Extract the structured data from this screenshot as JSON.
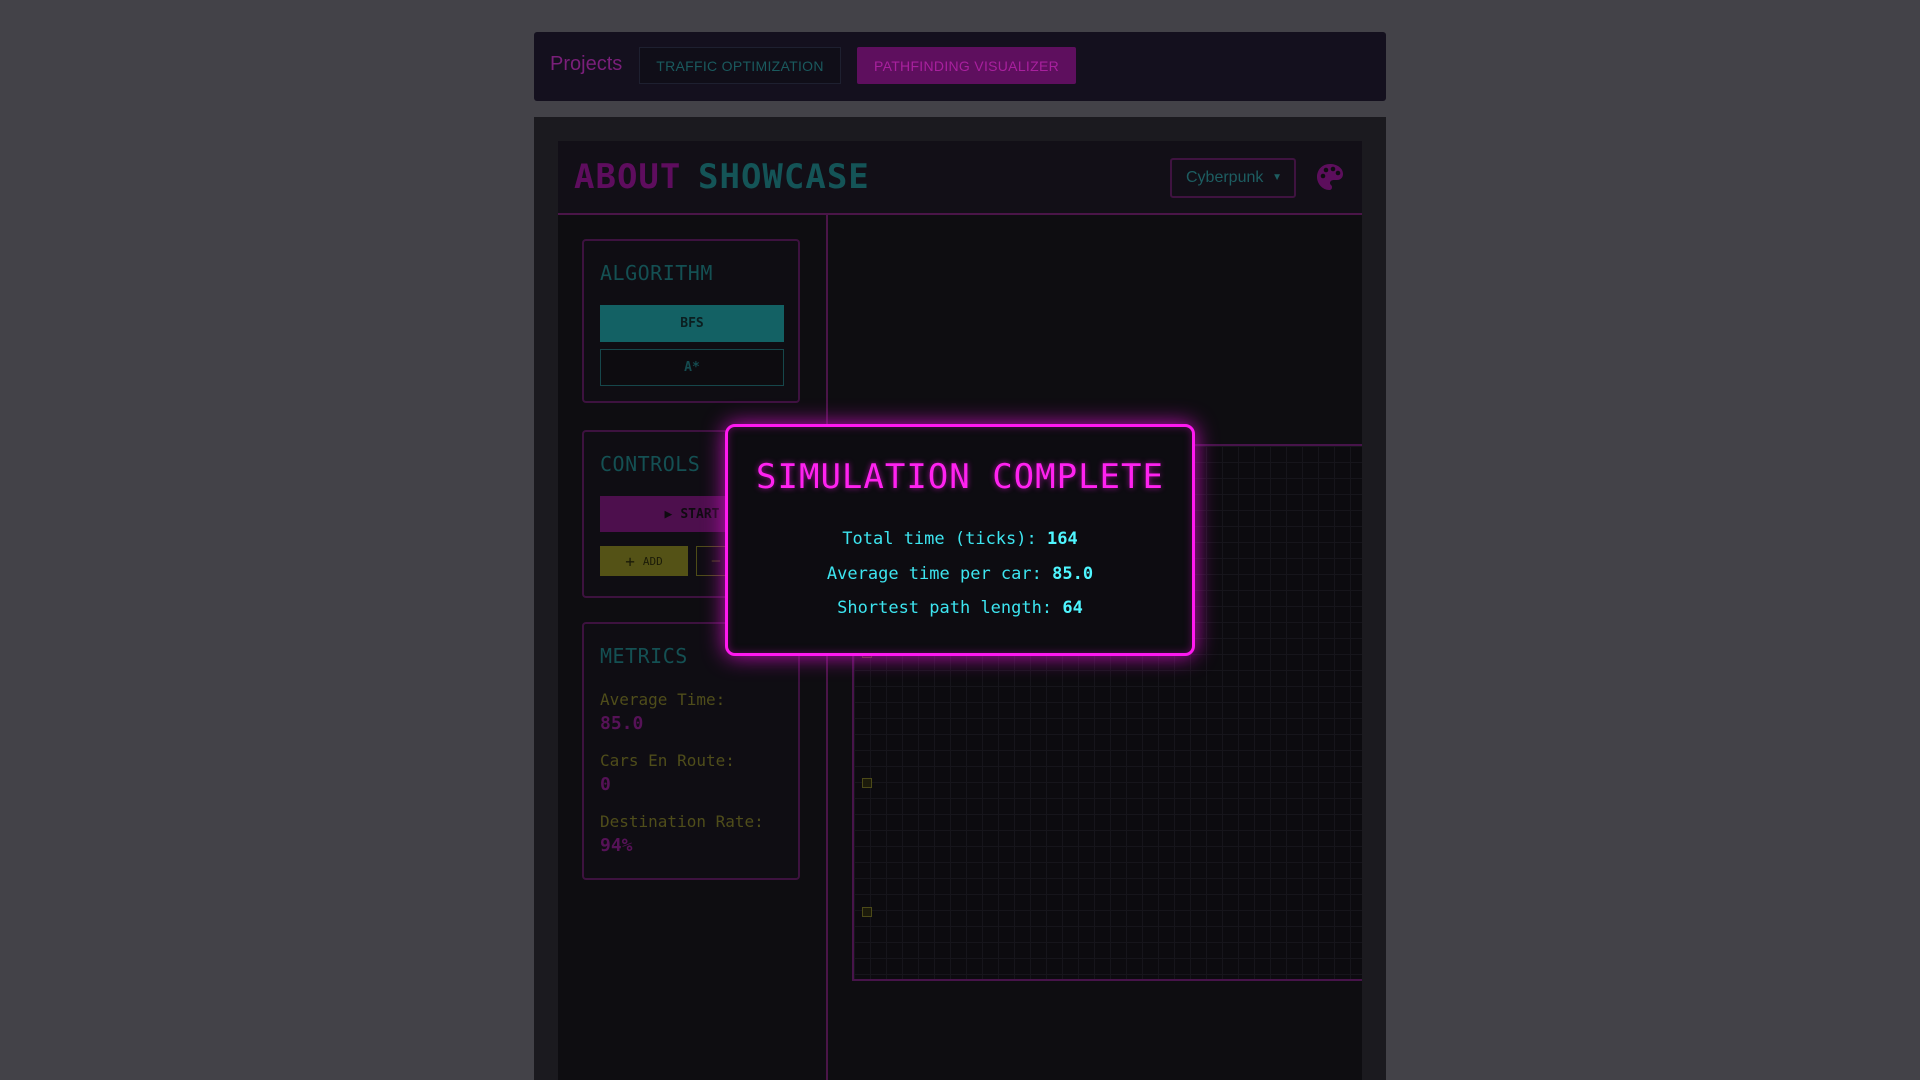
{
  "nav": {
    "brand": "Projects",
    "tabs": [
      "TRAFFIC OPTIMIZATION",
      "PATHFINDING VISUALIZER"
    ]
  },
  "header": {
    "about": "ABOUT",
    "showcase": "SHOWCASE",
    "theme_selected": "Cyberpunk",
    "palette_icon": "palette-icon"
  },
  "algorithm": {
    "title": "ALGORITHM",
    "options": [
      "BFS",
      "A*"
    ],
    "selected": "BFS"
  },
  "controls": {
    "title": "CONTROLS",
    "start_label": "START",
    "add_label": "ADD",
    "remove_symbol": "—"
  },
  "metrics": {
    "title": "METRICS",
    "items": [
      {
        "label": "Average Time:",
        "value": "85.0"
      },
      {
        "label": "Cars En Route:",
        "value": "0"
      },
      {
        "label": "Destination Rate:",
        "value": "94%"
      }
    ]
  },
  "modal": {
    "title": "SIMULATION COMPLETE",
    "stats": [
      {
        "label": "Total time (ticks):",
        "value": "164"
      },
      {
        "label": "Average time per car:",
        "value": "85.0"
      },
      {
        "label": "Shortest path length:",
        "value": "64"
      }
    ]
  },
  "colors": {
    "accent_magenta": "#ff19f0",
    "accent_cyan": "#3de5f0",
    "accent_yellow": "#545216"
  }
}
